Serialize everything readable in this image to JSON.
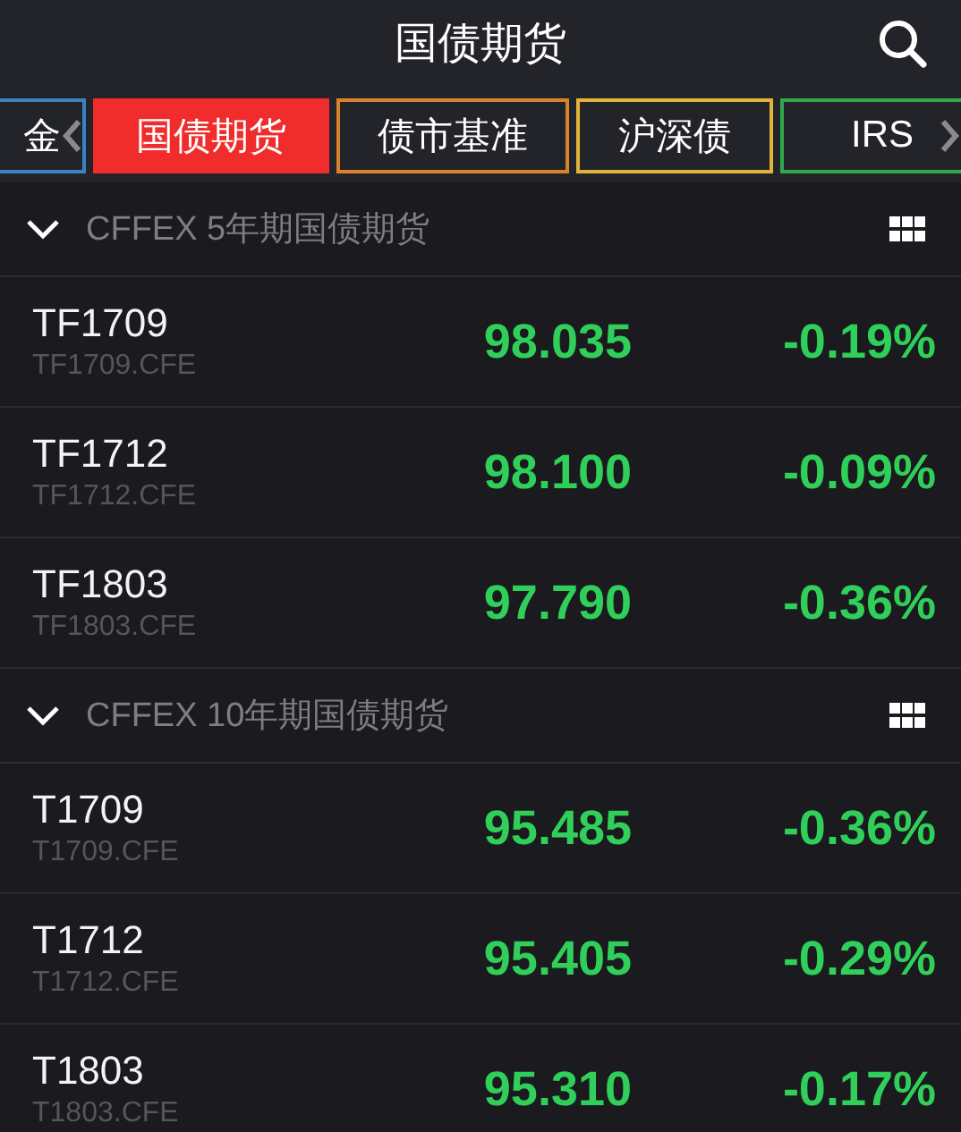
{
  "header": {
    "title": "国债期货"
  },
  "tabs": [
    {
      "label": "金",
      "selected": false,
      "color": "#3b82c4"
    },
    {
      "label": "国债期货",
      "selected": true,
      "color": "#f02c2c"
    },
    {
      "label": "债市基准",
      "selected": false,
      "color": "#d9822b"
    },
    {
      "label": "沪深债",
      "selected": false,
      "color": "#e0b43a"
    },
    {
      "label": "IRS",
      "selected": false,
      "color": "#2fa84f"
    }
  ],
  "sections": [
    {
      "title": "CFFEX 5年期国债期货",
      "expanded": true,
      "rows": [
        {
          "name": "TF1709",
          "code": "TF1709.CFE",
          "price": "98.035",
          "change": "-0.19%"
        },
        {
          "name": "TF1712",
          "code": "TF1712.CFE",
          "price": "98.100",
          "change": "-0.09%"
        },
        {
          "name": "TF1803",
          "code": "TF1803.CFE",
          "price": "97.790",
          "change": "-0.36%"
        }
      ]
    },
    {
      "title": "CFFEX 10年期国债期货",
      "expanded": true,
      "rows": [
        {
          "name": "T1709",
          "code": "T1709.CFE",
          "price": "95.485",
          "change": "-0.36%"
        },
        {
          "name": "T1712",
          "code": "T1712.CFE",
          "price": "95.405",
          "change": "-0.29%"
        },
        {
          "name": "T1803",
          "code": "T1803.CFE",
          "price": "95.310",
          "change": "-0.17%"
        }
      ]
    }
  ]
}
